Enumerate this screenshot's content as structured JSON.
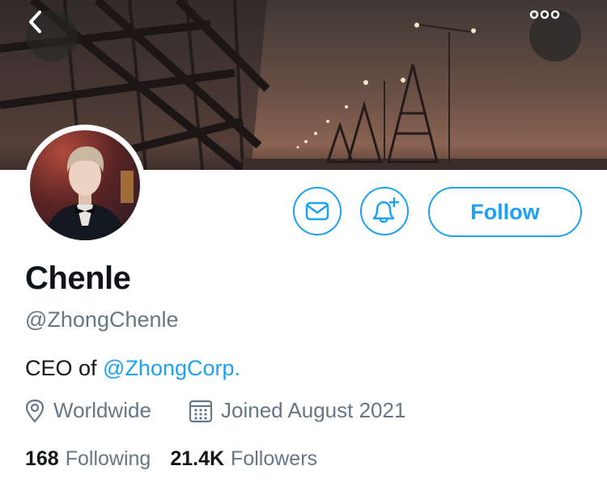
{
  "profile": {
    "name": "Chenle",
    "handle": "@ZhongChenle",
    "bio_prefix": "CEO of ",
    "bio_mention": "@ZhongCorp.",
    "location": "Worldwide",
    "joined": "Joined August 2021"
  },
  "actions": {
    "follow_label": "Follow",
    "message_icon": "envelope-icon",
    "notify_icon": "bell-plus-icon",
    "back_icon": "chevron-left-icon",
    "more_icon": "ellipsis-icon"
  },
  "stats": {
    "following_count": "168",
    "following_label": "Following",
    "followers_count": "21.4K",
    "followers_label": "Followers"
  },
  "colors": {
    "accent": "#1da1f2",
    "secondary_text": "#657786",
    "primary_text": "#14171a"
  }
}
